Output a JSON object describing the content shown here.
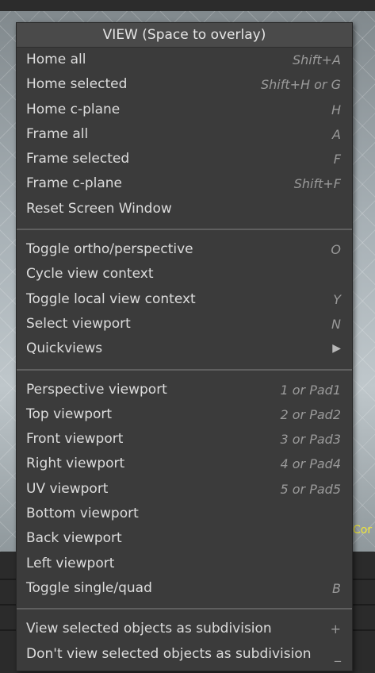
{
  "menu": {
    "title": "VIEW (Space to overlay)",
    "sections": [
      [
        {
          "label": "Home all",
          "shortcut": "Shift+A"
        },
        {
          "label": "Home selected",
          "shortcut": "Shift+H or G"
        },
        {
          "label": "Home c-plane",
          "shortcut": "H"
        },
        {
          "label": "Frame all",
          "shortcut": "A"
        },
        {
          "label": "Frame selected",
          "shortcut": "F"
        },
        {
          "label": "Frame c-plane",
          "shortcut": "Shift+F"
        },
        {
          "label": "Reset Screen Window",
          "shortcut": ""
        }
      ],
      [
        {
          "label": "Toggle ortho/perspective",
          "shortcut": "O"
        },
        {
          "label": "Cycle view context",
          "shortcut": ""
        },
        {
          "label": "Toggle local view context",
          "shortcut": "Y"
        },
        {
          "label": "Select viewport",
          "shortcut": "N"
        },
        {
          "label": "Quickviews",
          "shortcut": "▶"
        }
      ],
      [
        {
          "label": "Perspective viewport",
          "shortcut": "1 or Pad1"
        },
        {
          "label": "Top viewport",
          "shortcut": "2 or Pad2"
        },
        {
          "label": "Front viewport",
          "shortcut": "3 or Pad3"
        },
        {
          "label": "Right viewport",
          "shortcut": "4 or Pad4"
        },
        {
          "label": "UV viewport",
          "shortcut": "5 or Pad5"
        },
        {
          "label": "Bottom viewport",
          "shortcut": ""
        },
        {
          "label": "Back viewport",
          "shortcut": ""
        },
        {
          "label": "Left viewport",
          "shortcut": ""
        },
        {
          "label": "Toggle single/quad",
          "shortcut": "B"
        }
      ],
      [
        {
          "label": "View selected objects as subdivision",
          "shortcut": "+"
        },
        {
          "label": "Don't view selected objects as subdivision",
          "shortcut": "_"
        }
      ]
    ]
  },
  "background": {
    "overlay_text": "Cor"
  }
}
